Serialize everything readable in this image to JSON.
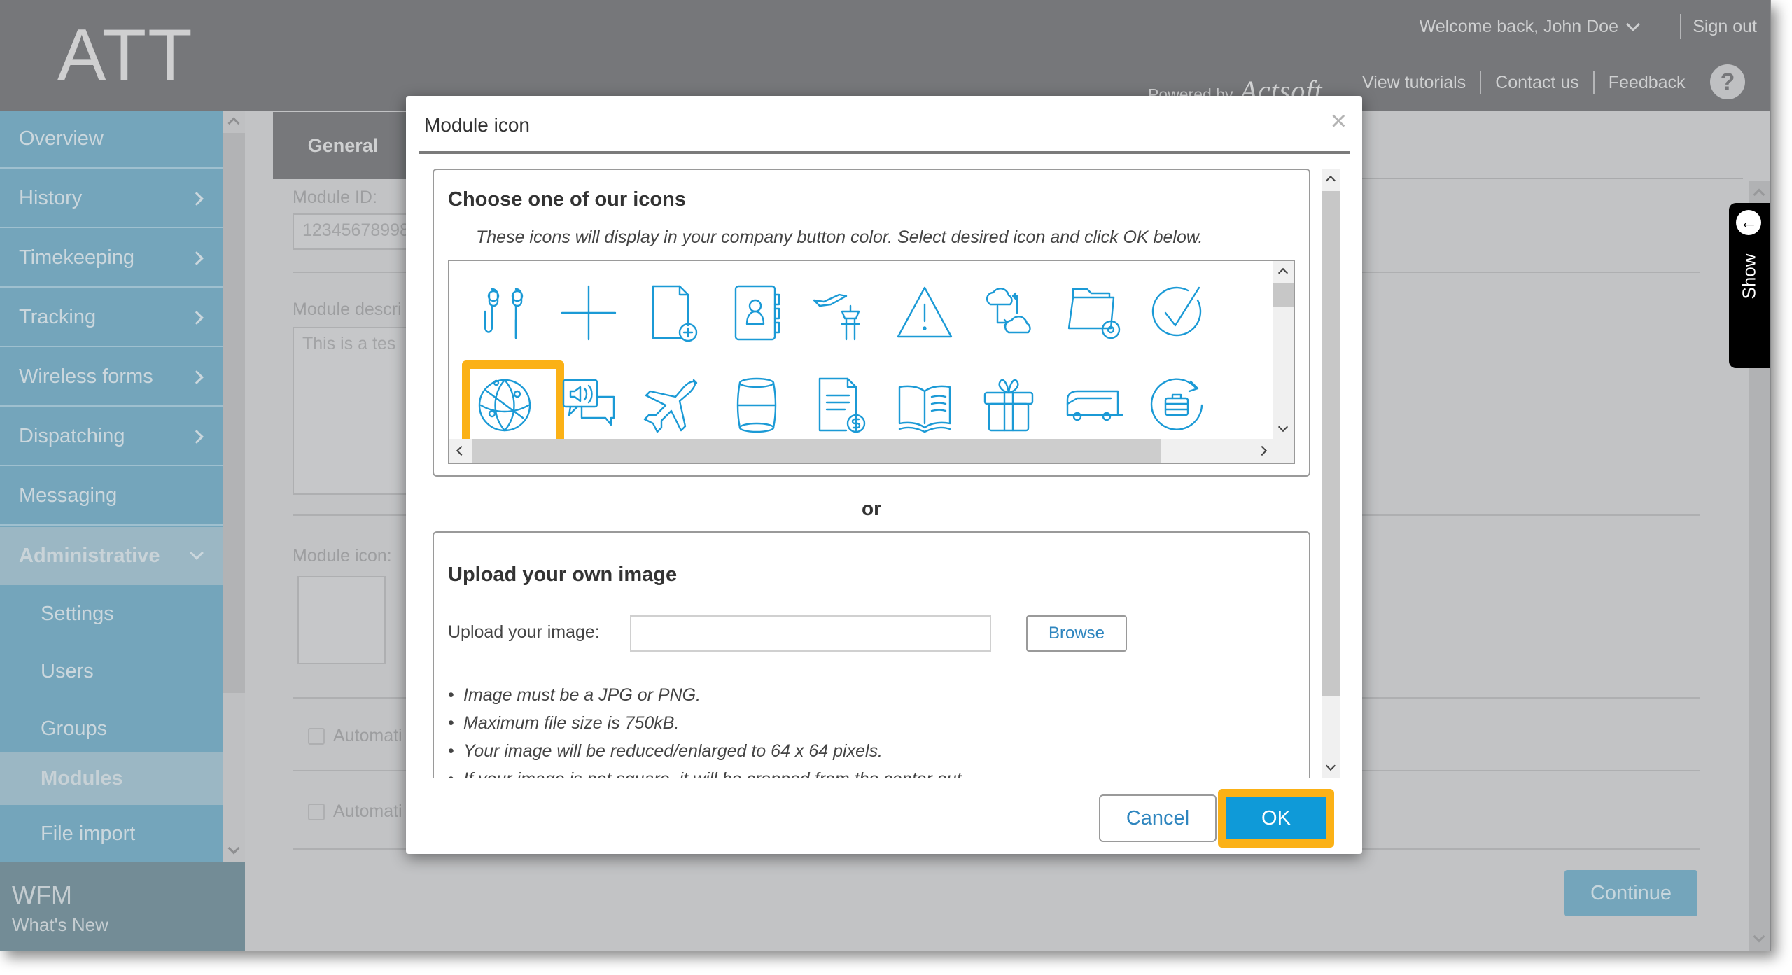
{
  "header": {
    "logo": "ATT",
    "welcome": "Welcome back, John Doe",
    "sign_out": "Sign out",
    "powered_by": "Powered by",
    "brand": "Actsoft",
    "links": [
      "View tutorials",
      "Contact us",
      "Feedback"
    ],
    "help": "?"
  },
  "sidebar": {
    "items": [
      {
        "label": "Overview",
        "has_arrow": false
      },
      {
        "label": "History",
        "has_arrow": true
      },
      {
        "label": "Timekeeping",
        "has_arrow": true
      },
      {
        "label": "Tracking",
        "has_arrow": true
      },
      {
        "label": "Wireless forms",
        "has_arrow": true
      },
      {
        "label": "Dispatching",
        "has_arrow": true
      },
      {
        "label": "Messaging",
        "has_arrow": false
      },
      {
        "label": "Administrative",
        "has_arrow": true,
        "expanded": true
      }
    ],
    "sub_items": [
      {
        "label": "Settings"
      },
      {
        "label": "Users"
      },
      {
        "label": "Groups"
      },
      {
        "label": "Modules",
        "active": true
      },
      {
        "label": "File import"
      }
    ],
    "footer": {
      "title": "WFM",
      "subtitle": "What's New"
    }
  },
  "main": {
    "tab_general": "General",
    "module_id_label": "Module ID:",
    "module_id_value": "12345678998",
    "module_desc_label": "Module descri",
    "module_desc_value": "This is a tes",
    "module_icon_label": "Module icon:",
    "auto_label_1": "Automati",
    "auto_label_2": "Automati",
    "continue": "Continue",
    "show_tab": "Show"
  },
  "modal": {
    "title": "Module icon",
    "close": "×",
    "choose_heading": "Choose one of our icons",
    "choose_note": "These icons will display in your company button color. Select desired icon and click OK below.",
    "icons": [
      {
        "name": "earbuds-icon",
        "selected": false
      },
      {
        "name": "plus-icon",
        "selected": false
      },
      {
        "name": "add-document-icon",
        "selected": false
      },
      {
        "name": "contact-book-icon",
        "selected": false
      },
      {
        "name": "airport-tower-icon",
        "selected": false
      },
      {
        "name": "warning-icon",
        "selected": false
      },
      {
        "name": "cloud-sync-icon",
        "selected": false
      },
      {
        "name": "folder-settings-icon",
        "selected": false
      },
      {
        "name": "check-circle-icon",
        "selected": false
      },
      {
        "name": "globe-network-icon",
        "selected": true
      },
      {
        "name": "audio-chat-icon",
        "selected": false
      },
      {
        "name": "airplane-icon",
        "selected": false
      },
      {
        "name": "barrel-icon",
        "selected": false
      },
      {
        "name": "invoice-icon",
        "selected": false
      },
      {
        "name": "open-book-icon",
        "selected": false
      },
      {
        "name": "gift-icon",
        "selected": false
      },
      {
        "name": "bus-icon",
        "selected": false
      },
      {
        "name": "briefcase-refresh-icon",
        "selected": false
      }
    ],
    "or": "or",
    "upload_heading": "Upload your own image",
    "upload_label": "Upload your image:",
    "upload_value": "",
    "browse": "Browse",
    "rules": [
      "Image must be a JPG or PNG.",
      "Maximum file size is 750kB.",
      "Your image will be reduced/enlarged to 64 x 64 pixels.",
      "If your image is not square, it will be cropped from the center out."
    ],
    "cancel": "Cancel",
    "ok": "OK"
  },
  "colors": {
    "accent": "#0f9ad8",
    "icon_stroke": "#1b9ad6",
    "highlight": "#fbb116",
    "sidebar": "#74a5bb",
    "header": "#76777a"
  }
}
